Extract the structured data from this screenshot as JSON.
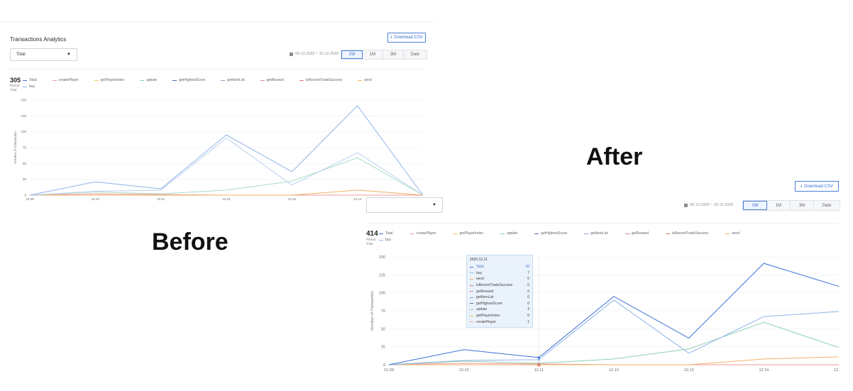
{
  "before": {
    "title": "Transactions Analytics",
    "download_label": "Download CSV",
    "download_icon": "download-icon",
    "select_value": "Total",
    "date_range": "09.12.2020 ~ 15.12.2020",
    "calendar_icon": "calendar-icon",
    "periods": [
      "1W",
      "1M",
      "3M",
      "Date"
    ],
    "active_period": "1W",
    "total_value": "305",
    "period_label": "Period",
    "total_label": "Total",
    "caption": "Before"
  },
  "after": {
    "download_label": "Download CSV",
    "download_icon": "download-icon",
    "select_value": "",
    "date_range": "09.12.2020 ~ 15.12.2020",
    "calendar_icon": "calendar-icon",
    "periods": [
      "1W",
      "1M",
      "3M",
      "Date"
    ],
    "active_period": "1W",
    "total_value": "414",
    "period_label": "Period",
    "total_label": "Total",
    "caption": "After",
    "tooltip": {
      "date": "2020.12.11",
      "rows": [
        {
          "name": "Total",
          "value": "10",
          "color": "#3d6fd6",
          "highlight": true
        },
        {
          "name": "buy",
          "value": "7",
          "color": "#8fb3e6"
        },
        {
          "name": "send",
          "value": "0",
          "color": "#f0b36a"
        },
        {
          "name": "isRecentTradeSuccess",
          "value": "0",
          "color": "#e57373"
        },
        {
          "name": "getReward",
          "value": "0",
          "color": "#e07c95"
        },
        {
          "name": "getItemList",
          "value": "0",
          "color": "#8ea3c9"
        },
        {
          "name": "getHighestScore",
          "value": "0",
          "color": "#4a6fa5"
        },
        {
          "name": "update",
          "value": "2",
          "color": "#8fcfb0"
        },
        {
          "name": "getPlayerIndex",
          "value": "0",
          "color": "#f2c45a"
        },
        {
          "name": "createPlayer",
          "value": "1",
          "color": "#f29a9a"
        }
      ]
    }
  },
  "legend": [
    {
      "name": "Total",
      "color": "#3d6fd6"
    },
    {
      "name": "createPlayer",
      "color": "#f29a9a"
    },
    {
      "name": "getPlayerIndex",
      "color": "#f2c45a"
    },
    {
      "name": "update",
      "color": "#8fcfb0"
    },
    {
      "name": "getHighestScore",
      "color": "#4a6fa5"
    },
    {
      "name": "getItemList",
      "color": "#8ea3c9"
    },
    {
      "name": "getReward",
      "color": "#e07c95"
    },
    {
      "name": "isRecentTradeSuccess",
      "color": "#e57373"
    },
    {
      "name": "send",
      "color": "#f0b36a"
    },
    {
      "name": "buy",
      "color": "#8fb3e6"
    }
  ],
  "chart_data": [
    {
      "type": "line",
      "ylabel": "Number of Transaction",
      "xlabel": "",
      "x": [
        "12.09",
        "12.10",
        "12.11",
        "12.12",
        "12.13",
        "12.14",
        "12.15"
      ],
      "ylim": [
        0,
        150
      ],
      "yticks": [
        0,
        25,
        50,
        75,
        100,
        125,
        150
      ],
      "series": [
        {
          "name": "Total",
          "color": "#8fb3e6",
          "values": [
            0,
            21,
            10,
            95,
            37,
            141,
            0
          ]
        },
        {
          "name": "buy",
          "color": "#b9d0f0",
          "values": [
            0,
            6,
            8,
            90,
            16,
            67,
            0
          ]
        },
        {
          "name": "update",
          "color": "#a8dcc4",
          "values": [
            0,
            5,
            2,
            8,
            22,
            59,
            0
          ]
        },
        {
          "name": "send",
          "color": "#f0b36a",
          "values": [
            0,
            0,
            0,
            0,
            0,
            8,
            0
          ]
        },
        {
          "name": "createPlayer",
          "color": "#f29a9a",
          "values": [
            0,
            2,
            1,
            0,
            0,
            0,
            0
          ]
        }
      ]
    },
    {
      "type": "line",
      "ylabel": "Number of Transaction",
      "xlabel": "",
      "x": [
        "12.09",
        "12.10",
        "12.11",
        "12.12",
        "12.13",
        "12.14",
        "12.15"
      ],
      "ylim": [
        0,
        150
      ],
      "yticks": [
        0,
        25,
        50,
        75,
        100,
        125,
        150
      ],
      "series": [
        {
          "name": "Total",
          "color": "#3d6fd6",
          "values": [
            0,
            21,
            10,
            95,
            37,
            141,
            109
          ]
        },
        {
          "name": "buy",
          "color": "#8fb3e6",
          "values": [
            0,
            6,
            7,
            90,
            16,
            67,
            74
          ]
        },
        {
          "name": "update",
          "color": "#8fcfb0",
          "values": [
            0,
            5,
            2,
            8,
            22,
            59,
            24
          ]
        },
        {
          "name": "send",
          "color": "#f0b36a",
          "values": [
            0,
            0,
            0,
            0,
            0,
            8,
            11
          ]
        },
        {
          "name": "createPlayer",
          "color": "#f29a9a",
          "values": [
            0,
            2,
            1,
            0,
            0,
            0,
            0
          ]
        }
      ]
    }
  ]
}
